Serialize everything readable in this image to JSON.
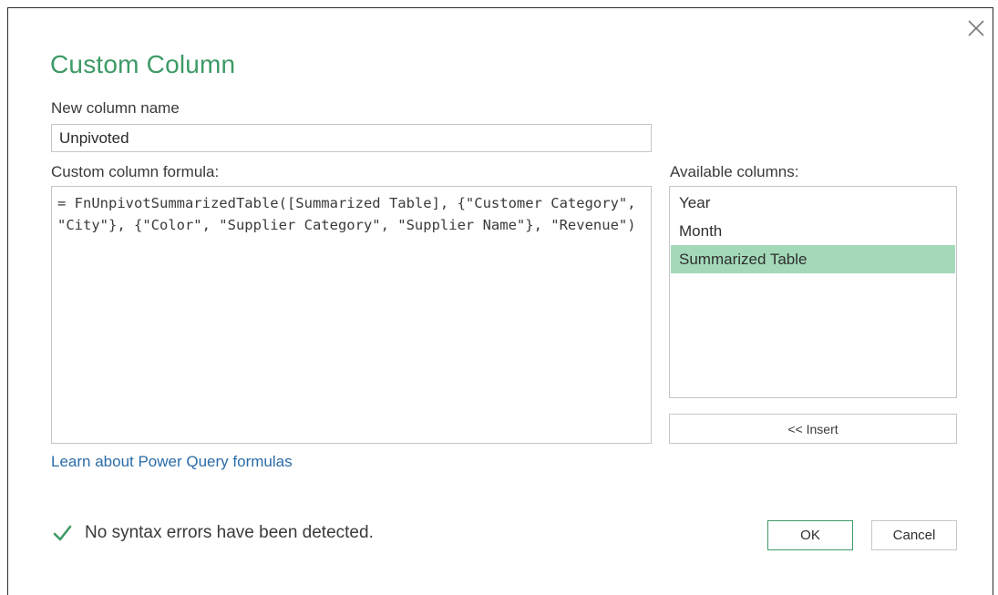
{
  "dialog": {
    "title": "Custom Column",
    "close_icon": "close-icon"
  },
  "new_column": {
    "label": "New column name",
    "value": "Unpivoted"
  },
  "formula": {
    "label": "Custom column formula:",
    "value": "= FnUnpivotSummarizedTable([Summarized Table], {\"Customer Category\", \"City\"}, {\"Color\", \"Supplier Category\", \"Supplier Name\"}, \"Revenue\")"
  },
  "available_columns": {
    "label": "Available columns:",
    "items": [
      {
        "label": "Year",
        "selected": false
      },
      {
        "label": "Month",
        "selected": false
      },
      {
        "label": "Summarized Table",
        "selected": true
      }
    ],
    "insert_label": "<< Insert"
  },
  "learn_link": "Learn about Power Query formulas",
  "status": {
    "icon": "checkmark-icon",
    "text": "No syntax errors have been detected."
  },
  "buttons": {
    "ok": "OK",
    "cancel": "Cancel"
  },
  "colors": {
    "accent": "#3d9a66",
    "selection": "#a3d9b8",
    "link": "#2b6ca8"
  }
}
